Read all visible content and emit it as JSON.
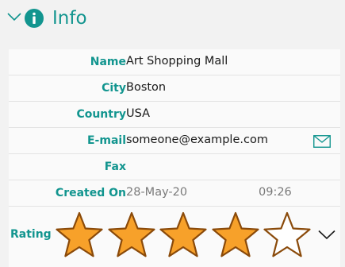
{
  "header": {
    "title": "Info",
    "chevron_icon": "chevron-down-icon",
    "info_icon": "info-circle-icon",
    "accent_color": "#12958f"
  },
  "fields": {
    "name": {
      "label": "Name",
      "value": "Art Shopping Mall"
    },
    "city": {
      "label": "City",
      "value": "Boston"
    },
    "country": {
      "label": "Country",
      "value": "USA"
    },
    "email": {
      "label": "E-mail",
      "value": "someone@example.com",
      "action_icon": "mail-icon"
    },
    "fax": {
      "label": "Fax",
      "value": ""
    },
    "created_on": {
      "label": "Created On",
      "date": "28-May-20",
      "time": "09:26"
    }
  },
  "rating": {
    "label": "Rating",
    "value": 4,
    "max": 5,
    "filled_color": "#f7a12a",
    "outline_color": "#8a4a0a",
    "dropdown_icon": "chevron-down-icon"
  }
}
